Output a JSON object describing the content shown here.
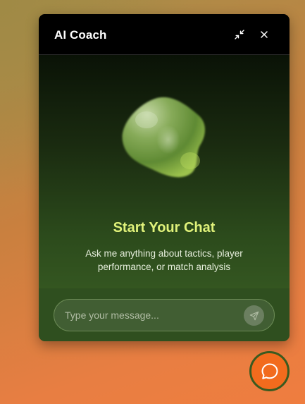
{
  "chat": {
    "title": "AI Coach",
    "heading": "Start Your Chat",
    "subtext": "Ask me anything about tactics, player performance, or match analysis",
    "input_placeholder": "Type your message...",
    "input_value": ""
  },
  "icons": {
    "minimize": "minimize-icon",
    "close": "close-icon",
    "send": "send-icon",
    "chat_launcher": "chat-bubble-icon"
  },
  "colors": {
    "heading_accent": "#e0f27a",
    "launcher_bg": "#f26b1d",
    "launcher_border": "#3a5a1f"
  }
}
